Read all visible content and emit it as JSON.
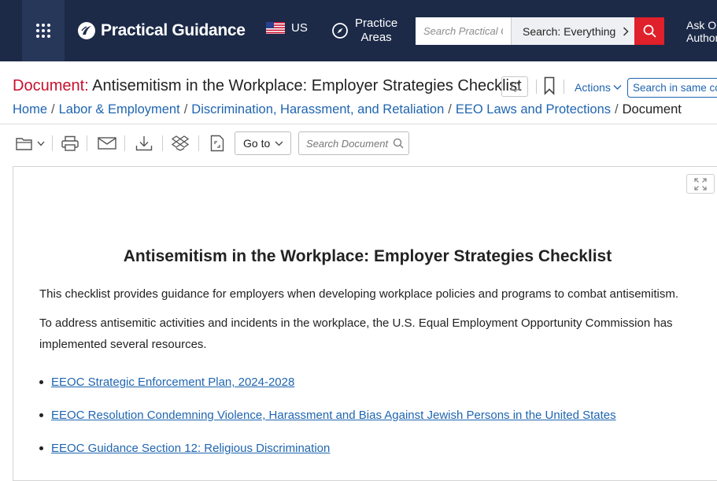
{
  "nav": {
    "brand": "Practical Guidance",
    "region": "US",
    "practice_line1": "Practice",
    "practice_line2": "Areas",
    "search_placeholder": "Search Practical Guidance",
    "search_scope": "Search: Everything",
    "ask_line1": "Ask Our",
    "ask_line2": "Authors"
  },
  "doc_header": {
    "label": "Document:",
    "title": "Antisemitism in the Workplace: Employer Strategies Checklist",
    "actions": "Actions",
    "same_search": "Search in same content type"
  },
  "breadcrumb": {
    "items": [
      "Home",
      "Labor & Employment",
      "Discrimination, Harassment, and Retaliation",
      "EEO Laws and Protections"
    ],
    "current": "Document"
  },
  "toolbar": {
    "goto": "Go to",
    "search_placeholder": "Search Document"
  },
  "content": {
    "heading": "Antisemitism in the Workplace: Employer Strategies Checklist",
    "p1": "This checklist provides guidance for employers when developing workplace policies and programs to combat antisemitism.",
    "p2": "To address antisemitic activities and incidents in the workplace, the U.S. Equal Employment Opportunity Commission has implemented several resources.",
    "links": [
      "EEOC Strategic Enforcement Plan, 2024-2028",
      "EEOC Resolution Condemning Violence, Harassment and Bias Against Jewish Persons in the United States",
      "EEOC Guidance Section 12: Religious Discrimination"
    ]
  },
  "colors": {
    "navbar": "#1c2a48",
    "accent_red": "#e0202a",
    "link_blue": "#1f65b0",
    "label_red": "#c8102e"
  },
  "icons": [
    "app-grid-icon",
    "brand-logo-icon",
    "us-flag-icon",
    "compass-icon",
    "chevron-right-icon",
    "search-icon",
    "bell-icon",
    "bookmark-icon",
    "chevron-down-icon",
    "folder-icon",
    "print-icon",
    "email-icon",
    "download-icon",
    "dropbox-icon",
    "document-icon",
    "expand-icon"
  ]
}
